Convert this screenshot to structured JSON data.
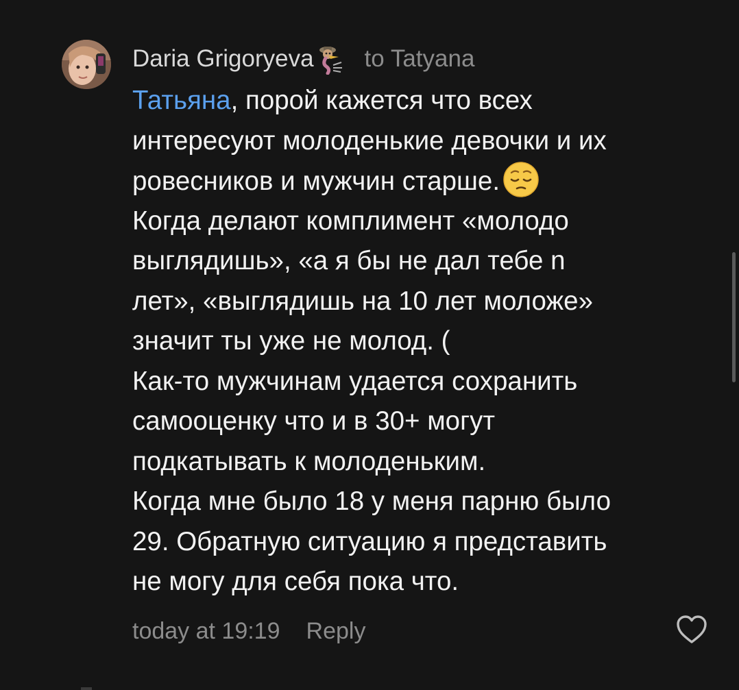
{
  "comment": {
    "author": "Daria Grigoryeva",
    "badge_icon": "ostrich-badge-icon",
    "reply_to": "to Tatyana",
    "mention": "Татьяна",
    "body_lines": [
      ", порой кажется что всех",
      "интересуют молоденькие девочки и их",
      "ровесников и мужчин старше.",
      "Когда делают комплимент «молодо",
      "выглядишь», «а я бы не дал тебе n",
      "лет», «выглядишь на 10 лет моложе»",
      "значит ты уже не молод. (",
      "Как-то мужчинам удается сохранить",
      "самооценку что и в 30+ могут",
      "подкатывать к молоденьким.",
      "Когда мне было 18 у меня парню было",
      "29. Обратную ситуацию я представить",
      "не могу для себя пока что."
    ],
    "emoji": "pensive-face-icon",
    "timestamp": "today at 19:19",
    "reply_label": "Reply",
    "like_icon": "heart-outline-icon"
  },
  "colors": {
    "background": "#151515",
    "text": "#f2f2f2",
    "muted": "#8c8c8c",
    "mention": "#5ba0ee"
  }
}
